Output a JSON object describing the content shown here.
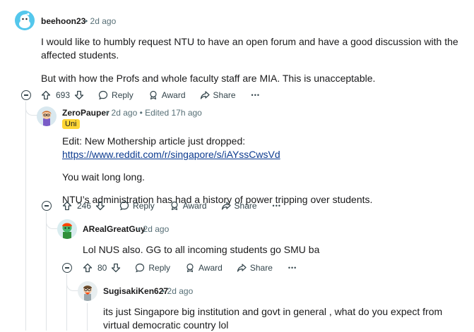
{
  "comments": [
    {
      "username": "beehoon23",
      "meta": "• 2d ago",
      "paragraphs": [
        "I would like to humbly request NTU to have an open forum and have a good discussion with the affected students.",
        "But with how the Profs and whole faculty staff are MIA. This is unacceptable."
      ],
      "votes": "693"
    },
    {
      "username": "ZeroPauper",
      "meta": "• 2d ago • Edited 17h ago",
      "flair": "Uni",
      "edit_prefix": "Edit: New Mothership article just dropped: ",
      "edit_link": "https://www.reddit.com/r/singapore/s/iAYssCwsVd",
      "paragraphs": [
        "You wait long long.",
        "NTU’s administration has had a history of power tripping over students."
      ],
      "votes": "246"
    },
    {
      "username": "ARealGreatGuy",
      "meta": "• 2d ago",
      "paragraphs": [
        "Lol NUS also. GG to all incoming students go SMU ba"
      ],
      "votes": "80"
    },
    {
      "username": "SugisakiKen627",
      "meta": "• 2d ago",
      "paragraphs": [
        "its just Singapore big institution and govt in general , what do you expect from virtual democratic country lol"
      ]
    }
  ],
  "actions": {
    "reply": "Reply",
    "award": "Award",
    "share": "Share",
    "more": "•••"
  },
  "colors": {
    "avatar_beehoon": "#54c7ec",
    "flair_uni": "#ffd635",
    "link": "#0b3a8f",
    "thread_line": "#dfe3e6"
  },
  "icons": [
    "upvote-icon",
    "downvote-icon",
    "reply-icon",
    "award-icon",
    "share-icon",
    "more-icon",
    "collapse-icon"
  ]
}
